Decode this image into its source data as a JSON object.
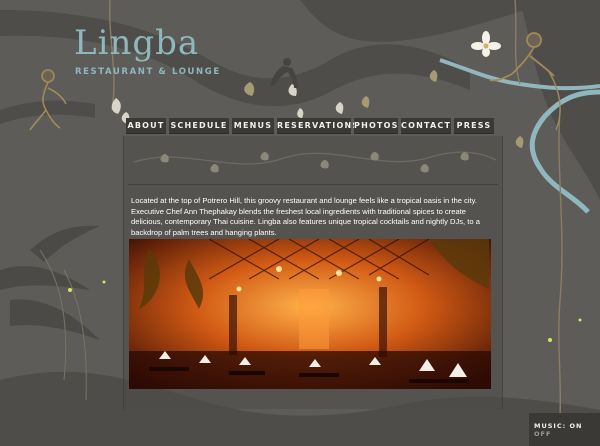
{
  "brand": {
    "name": "Lingba",
    "tagline": "RESTAURANT & LOUNGE"
  },
  "nav": [
    {
      "label": "ABOUT"
    },
    {
      "label": "SCHEDULE"
    },
    {
      "label": "MENUS"
    },
    {
      "label": "RESERVATIONS"
    },
    {
      "label": "PHOTOS"
    },
    {
      "label": "CONTACT"
    },
    {
      "label": "PRESS"
    }
  ],
  "content": {
    "intro": "Located at the top of Potrero Hill, this groovy restaurant and lounge feels like a tropical oasis in the city. Executive Chef Ann Thephakay blends the freshest local ingredients with traditional spices to create delicious, contemporary Thai cuisine. Lingba also features unique tropical cocktails and nightly DJs, to a backdrop of palm trees and hanging plants."
  },
  "music": {
    "label": "MUSIC:",
    "on": "ON",
    "off": "OFF"
  },
  "colors": {
    "background": "#5e5c58",
    "accent": "#8fb7bd",
    "nav_bg": "#3a3936",
    "text": "#ffffff"
  }
}
